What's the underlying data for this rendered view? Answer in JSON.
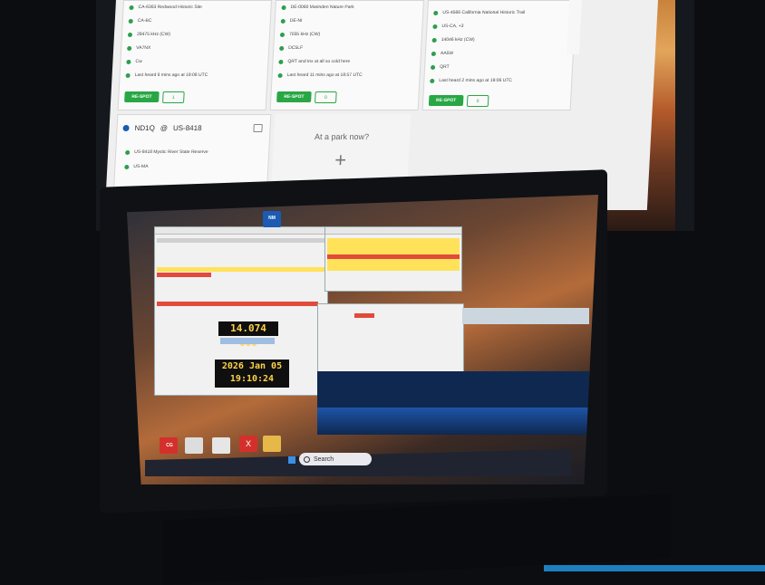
{
  "spot_cards": [
    {
      "park": "CA-6363 Redwood Historic Site",
      "location": "CA-BC",
      "frequency": "28475 kHz (CW)",
      "spotter": "VA7NX",
      "comment": "Cw",
      "heard": "Last heard 6 mins ago at 19:06 UTC",
      "respot": "RE-SPOT",
      "count": "1"
    },
    {
      "park": "DE-0060 Marinden Nature Park",
      "location": "DE-NI",
      "frequency": "7035 kHz (CW)",
      "spotter": "DC5LF",
      "comment": "QRT and tnx at all so cold here",
      "heard": "Last heard 11 mins ago at 18:57 UTC",
      "respot": "RE-SPOT",
      "count": "0"
    },
    {
      "park": "US-4566 California National Historic Trail",
      "location": "US-CA, +3",
      "frequency": "14046 kHz (CW)",
      "spotter": "AA5W",
      "comment": "QRT",
      "heard": "Last heard 2 mins ago at 19:06 UTC",
      "respot": "RE-SPOT",
      "count": "0"
    }
  ],
  "activator_card": {
    "callsign": "ND1Q",
    "at": "@",
    "park_ref": "US-8418",
    "park": "US-8418 Mystic River State Reserve",
    "location": "US-MA"
  },
  "park_tile": {
    "prompt": "At a park now?",
    "add_symbol": "+"
  },
  "laptop": {
    "frequency": "14.074 000",
    "date": "2026 Jan 05",
    "time": "19:10:24",
    "search_placeholder": "Search"
  },
  "desktop_icons": [
    {
      "label": "CG",
      "color": "#d4302b"
    },
    {
      "label": "Welcome to",
      "color": "#dddddd"
    },
    {
      "label": "Programs",
      "color": "#e6e6e6"
    },
    {
      "label": "X",
      "color": "#d4302b"
    },
    {
      "label": "NM",
      "color": "#1b5bb3"
    }
  ],
  "colors": {
    "accent_green": "#28a745",
    "highlight_yellow": "#ffe25a",
    "highlight_red": "#e24a3b",
    "readout_text": "#ffd24a"
  }
}
